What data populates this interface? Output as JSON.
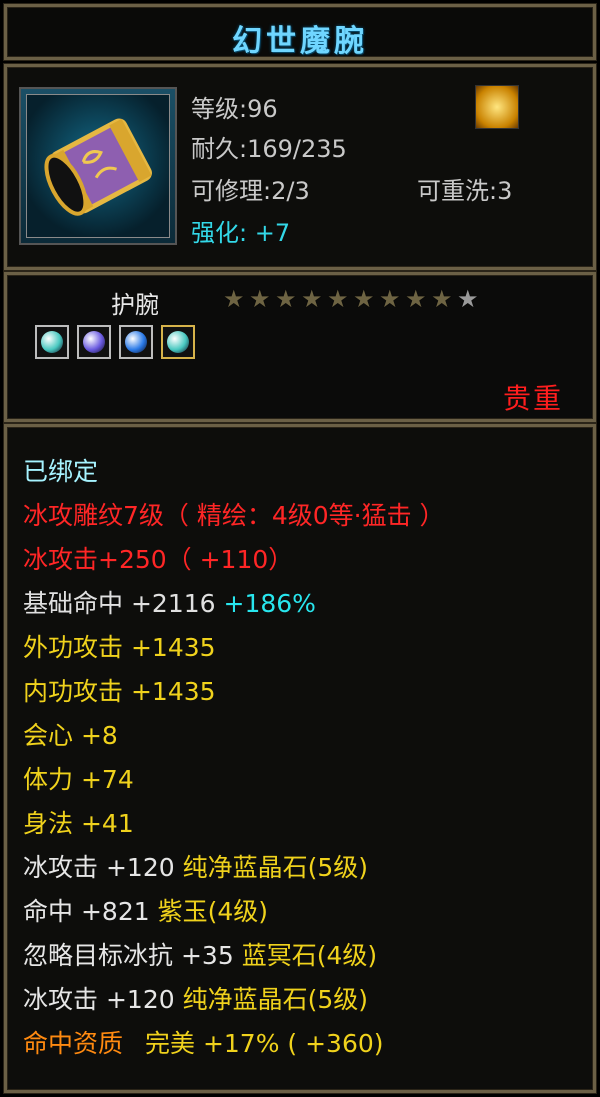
{
  "title": "幻世魔腕",
  "header": {
    "level": "等级:96",
    "durability": "耐久:169/235",
    "repairable": "可修理:2/3",
    "rewashable": "可重洗:3",
    "enhance_label": "强化:",
    "enhance_value": "+7",
    "badge_icon": "gold-dragon-icon",
    "item_icon": "purple-bracer-icon"
  },
  "mid": {
    "item_type": "护腕",
    "stars_filled": 9,
    "stars_total": 10,
    "gems": [
      {
        "icon": "teal-gem-icon",
        "color": "#48c8c0"
      },
      {
        "icon": "purple-gem-icon",
        "color": "#6a5ae0"
      },
      {
        "icon": "blue-gem-icon",
        "color": "#2a7ae8"
      },
      {
        "icon": "teal-gem-icon",
        "color": "#48c8c0"
      }
    ],
    "quality": "贵重"
  },
  "details": {
    "bound": "已绑定",
    "engrave": "冰攻雕纹7级（ 精绘：4级0等·猛击 ）",
    "ice_attack_main": "冰攻击+250（ +110）",
    "base_hit_label": "基础命中",
    "base_hit_value": "+2116",
    "base_hit_pct": "+186%",
    "outer_attack_label": "外功攻击",
    "outer_attack_value": "+1435",
    "inner_attack_label": "内功攻击",
    "inner_attack_value": "+1435",
    "crit_label": "会心",
    "crit_value": "+8",
    "stamina_label": "体力",
    "stamina_value": "+74",
    "agility_label": "身法",
    "agility_value": "+41",
    "gem_lines": [
      {
        "label": "冰攻击",
        "value": "+120",
        "gem": "纯净蓝晶石(5级)"
      },
      {
        "label": "命中",
        "value": "+821",
        "gem": "紫玉(4级)"
      },
      {
        "label": "忽略目标冰抗",
        "value": "+35",
        "gem": "蓝冥石(4级)"
      },
      {
        "label": "冰攻击",
        "value": "+120",
        "gem": "纯净蓝晶石(5级)"
      }
    ],
    "aptitude_label": "命中资质",
    "aptitude_grade": "完美",
    "aptitude_pct": "+17%",
    "aptitude_bonus": "( +360)"
  }
}
